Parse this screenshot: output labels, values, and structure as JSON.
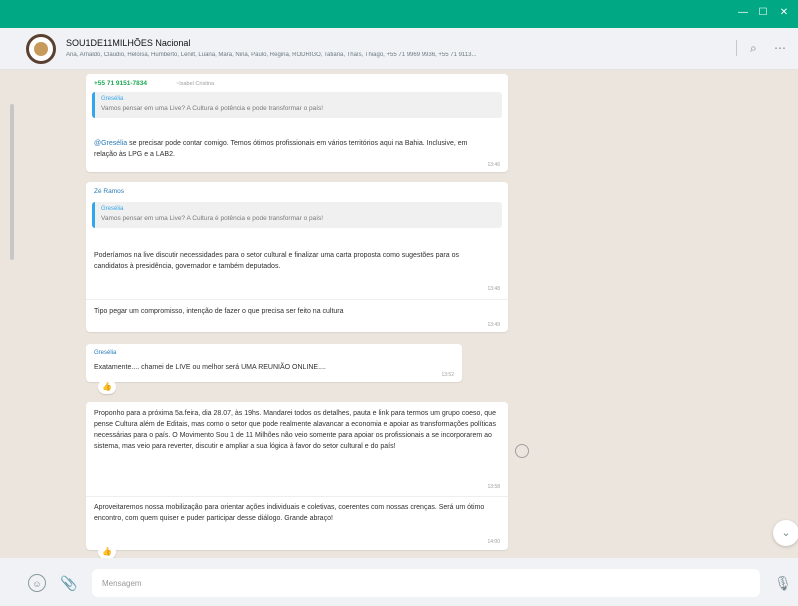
{
  "window": {
    "minimize": "—",
    "maximize": "☐",
    "close": "✕"
  },
  "header": {
    "group_name": "SOU1DE11MILHÕES Nacional",
    "members": "Ana, Arnaldo, Cláudio, Heloísa, Humberto, Lenilt, Luana, Mara, Nina, Paulo, Regina, RODRIGO, Tatiana, Thaís, Thiago, +55 71 9969 9936, +55 71 9113..."
  },
  "messages": [
    {
      "sender": "+55 71 9151-7834",
      "sender_extra": "~Isabel Cristina",
      "quote_author": "Gresélia",
      "quote_text": "Vamos pensar em uma Live? A Cultura é potência e pode transformar o país!",
      "text_mention": "@Gresélia",
      "text": " se precisar pode contar comigo. Temos ótimos profissionais em vários territórios aqui na Bahia. Inclusive, em relação às LPG e a LAB2.",
      "time": "13:46"
    },
    {
      "sender": "Zé Ramos",
      "quote_author": "Gresélia",
      "quote_text": "Vamos pensar em uma Live? A Cultura é potência e pode transformar o país!",
      "text": "Poderíamos na live discutir necessidades para o setor cultural e finalizar uma carta proposta como sugestões para os candidatos à presidência, governador e também deputados.",
      "time": "13:48"
    },
    {
      "text": "Tipo pegar um compromisso, intenção de fazer o que precisa ser feito na cultura",
      "time": "13:49"
    },
    {
      "sender": "Gresélia",
      "text": "Exatamente.... chamei de LIVE ou melhor será UMA REUNIÃO ONLINE....",
      "time": "13:52",
      "reaction": "👍"
    },
    {
      "text": "Proponho para a próxima 5a.feira, dia 28.07, às 19hs.  Mandarei todos os detalhes, pauta e link para termos um grupo coeso, que pense Cultura além de Editais, mas como o setor que pode realmente alavancar a economia e apoiar as transformações políticas necessárias para o país.  O Movimento Sou 1 de 11 Milhões não veio somente para apoiar os profissionais a se incorporarem ao sistema, mas veio para reverter, discutir e ampliar a sua lógica à favor do setor cultural e do país!",
      "time": "13:58"
    },
    {
      "text": "Aproveitaremos nossa mobilização para orientar ações individuais e coletivas, coerentes com nossas crenças. Será um ótimo encontro, com quem quiser e puder participar desse diálogo.  Grande abraço!",
      "time": "14:00",
      "reaction": "👍"
    }
  ],
  "footer": {
    "placeholder": "Mensagem"
  },
  "icons": {
    "emoji": "☺",
    "attach": "📎",
    "mic": "🎙",
    "search": "⌕",
    "menu": "⋯",
    "scroll_down": "⌄"
  },
  "colors": {
    "accent": "#00a884",
    "chat_bg": "#ece5dd",
    "quote_bar": "#35a6ec"
  }
}
